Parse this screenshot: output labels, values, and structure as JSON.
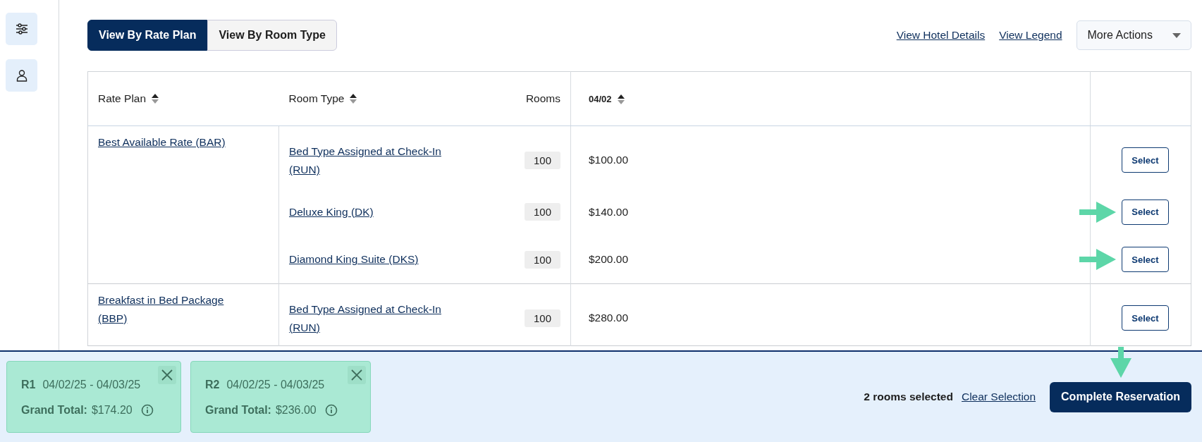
{
  "view_tabs": [
    {
      "label": "View By Rate Plan",
      "selected": true
    },
    {
      "label": "View By Room Type",
      "selected": false
    }
  ],
  "links": [
    "View Hotel Details",
    "View Legend"
  ],
  "more_actions": {
    "label": "More Actions"
  },
  "table": {
    "columns": [
      {
        "label": "Rate Plan",
        "sortable": true
      },
      {
        "label": "Room Type",
        "sortable": true
      },
      {
        "label": "Rooms",
        "sortable": false
      },
      {
        "label": "04/02",
        "sortable": true
      }
    ],
    "groups": [
      {
        "rate_plan": "Best Available Rate (BAR)",
        "rows": [
          {
            "room_type": "Bed Type Assigned at Check-In (RUN)",
            "rooms": "100",
            "price": "$100.00",
            "action": "Select",
            "arrow": false
          },
          {
            "room_type": "Deluxe King (DK)",
            "rooms": "100",
            "price": "$140.00",
            "action": "Select",
            "arrow": true
          },
          {
            "room_type": "Diamond King Suite (DKS)",
            "rooms": "100",
            "price": "$200.00",
            "action": "Select",
            "arrow": true
          }
        ]
      },
      {
        "rate_plan": "Breakfast in Bed Package (BBP)",
        "rows": [
          {
            "room_type": "Bed Type Assigned at Check-In (RUN)",
            "rooms": "100",
            "price": "$280.00",
            "action": "Select",
            "arrow": false
          }
        ]
      }
    ]
  },
  "selections": [
    {
      "label": "R1",
      "dates": "04/02/25 - 04/03/25",
      "total_label": "Grand Total:",
      "total": "$174.20"
    },
    {
      "label": "R2",
      "dates": "04/02/25 - 04/03/25",
      "total_label": "Grand Total:",
      "total": "$236.00"
    }
  ],
  "summary": "2 rooms selected",
  "clear": "Clear Selection",
  "complete": {
    "label": "Complete Reservation",
    "arrow": true
  }
}
